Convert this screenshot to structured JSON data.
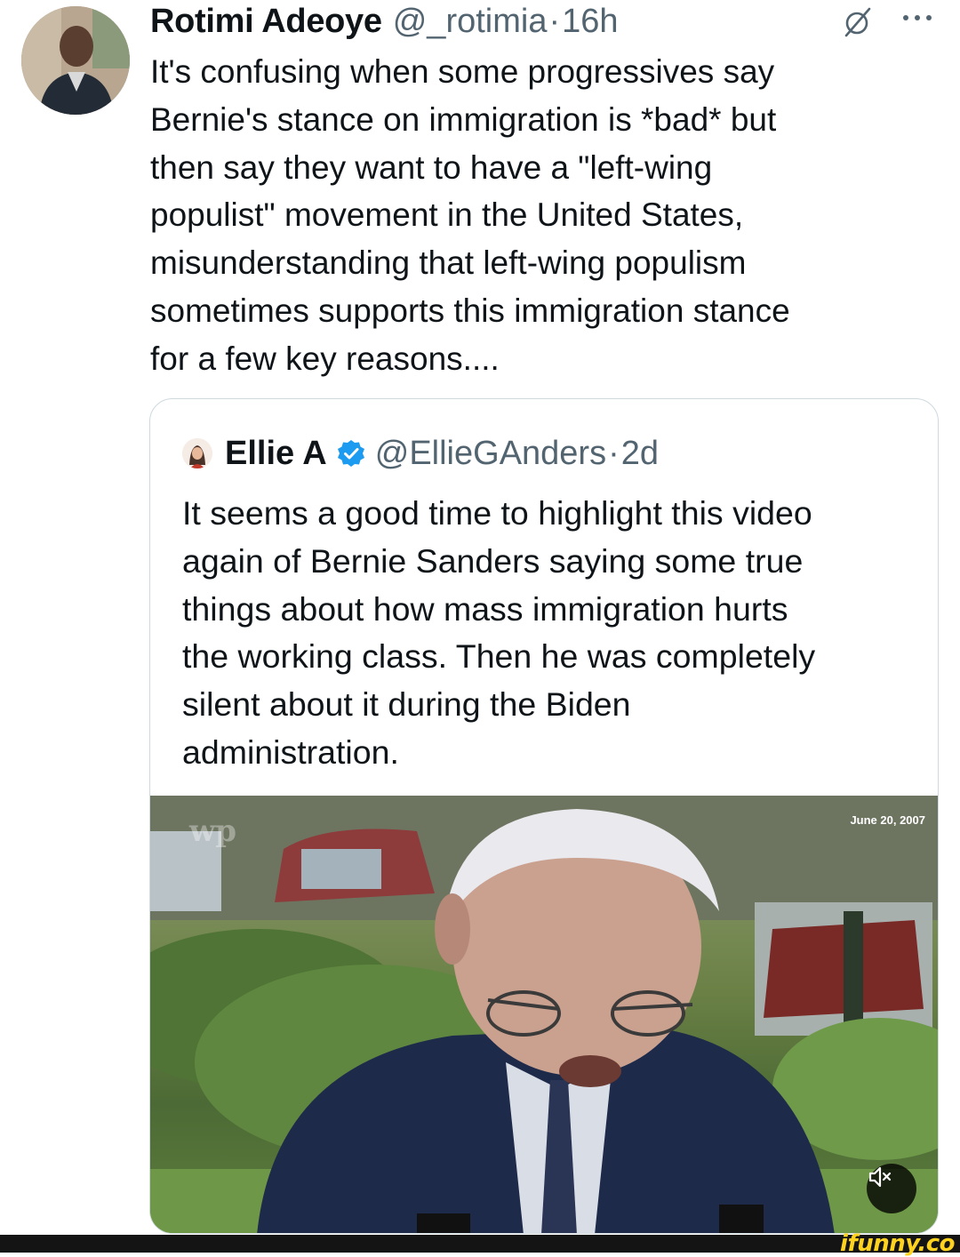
{
  "tweet": {
    "author_name": "Rotimi Adeoye",
    "author_handle": "@_rotimia",
    "separator": "·",
    "time": "16h",
    "text": "It's confusing when some progressives say\nBernie's stance on immigration is *bad* but\nthen say they want to have a \"left-wing\npopulist\" movement in the United States,\nmisunderstanding that left-wing populism\nsometimes supports this immigration stance\nfor a few key reasons....",
    "icons": {
      "grok": "grok-icon",
      "more": "more-dots-icon"
    }
  },
  "quoted_tweet": {
    "author_name": "Ellie A",
    "author_handle": "@EllieGAnders",
    "separator": "·",
    "time": "2d",
    "verified_color": "#1d9bf0",
    "text": "It seems a good time to highlight this video\nagain of Bernie Sanders saying some true\nthings about how mass immigration hurts\nthe working class. Then he was completely\nsilent about it during the Biden\nadministration.",
    "video": {
      "date_overlay": "June 20, 2007",
      "logo": "wp",
      "mute_icon": "speaker-muted-icon"
    }
  },
  "watermark": "ifunny.co",
  "colors": {
    "text": "#0f1419",
    "secondary": "#536471",
    "border": "#cfd9de",
    "watermark": "#ffd21f"
  }
}
